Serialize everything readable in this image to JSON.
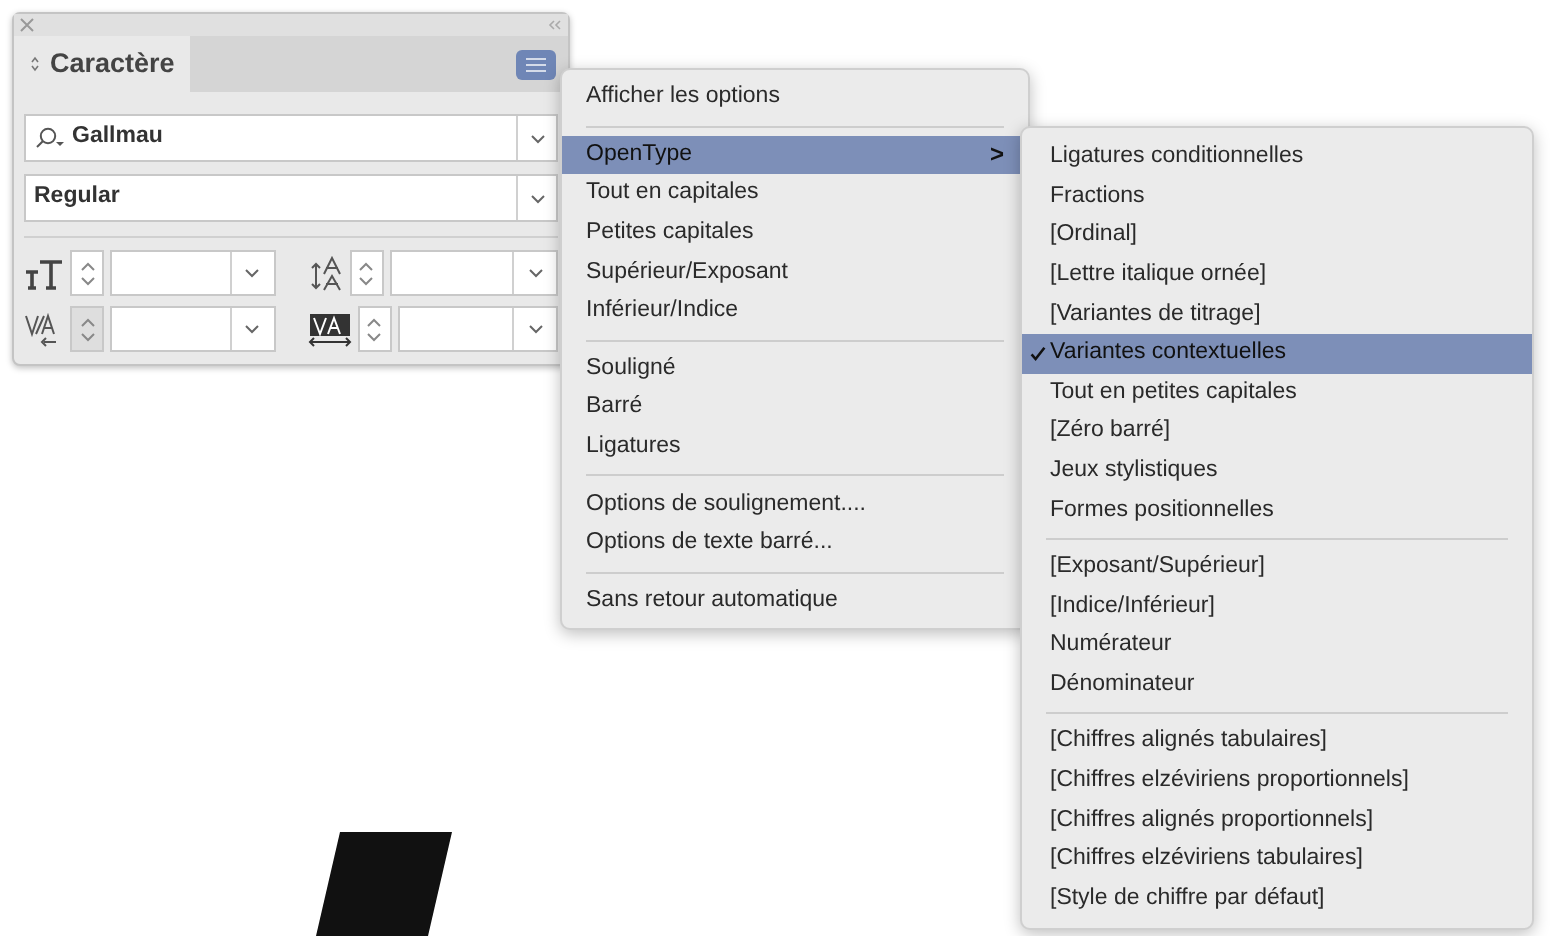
{
  "panel": {
    "tab": {
      "label": "Caractère",
      "selected": true
    },
    "font_family": {
      "value": "Gallmau"
    },
    "font_style": {
      "value": "Regular"
    }
  },
  "menu": {
    "items": [
      {
        "kind": "item",
        "label": "Afficher les options",
        "selected": false
      },
      {
        "kind": "separator"
      },
      {
        "kind": "submenu",
        "label": "OpenType",
        "arrow": ">",
        "selected": true
      },
      {
        "kind": "item",
        "label": "Tout en capitales",
        "selected": false
      },
      {
        "kind": "item",
        "label": "Petites capitales",
        "selected": false
      },
      {
        "kind": "item",
        "label": "Supérieur/Exposant",
        "selected": false
      },
      {
        "kind": "item",
        "label": "Inférieur/Indice",
        "selected": false
      },
      {
        "kind": "separator"
      },
      {
        "kind": "item",
        "label": "Souligné",
        "selected": false
      },
      {
        "kind": "item",
        "label": "Barré",
        "selected": false
      },
      {
        "kind": "item",
        "label": "Ligatures",
        "selected": false
      },
      {
        "kind": "separator"
      },
      {
        "kind": "item",
        "label": "Options de soulignement....",
        "selected": false
      },
      {
        "kind": "item",
        "label": "Options de texte barré...",
        "selected": false
      },
      {
        "kind": "separator"
      },
      {
        "kind": "item",
        "label": "Sans retour automatique",
        "selected": false
      }
    ]
  },
  "submenu": {
    "items": [
      {
        "kind": "item",
        "label": "Ligatures conditionnelles",
        "selected": false,
        "checked": false
      },
      {
        "kind": "item",
        "label": "Fractions",
        "selected": false,
        "checked": false
      },
      {
        "kind": "item",
        "label": "[Ordinal]",
        "selected": false,
        "checked": false
      },
      {
        "kind": "item",
        "label": "[Lettre italique ornée]",
        "selected": false,
        "checked": false
      },
      {
        "kind": "item",
        "label": "[Variantes de titrage]",
        "selected": false,
        "checked": false
      },
      {
        "kind": "item",
        "label": "Variantes contextuelles",
        "selected": true,
        "checked": true
      },
      {
        "kind": "item",
        "label": "Tout en petites capitales",
        "selected": false,
        "checked": false
      },
      {
        "kind": "item",
        "label": "[Zéro barré]",
        "selected": false,
        "checked": false
      },
      {
        "kind": "item",
        "label": "Jeux stylistiques",
        "selected": false,
        "checked": false
      },
      {
        "kind": "item",
        "label": "Formes positionnelles",
        "selected": false,
        "checked": false
      },
      {
        "kind": "separator"
      },
      {
        "kind": "item",
        "label": "[Exposant/Supérieur]",
        "selected": false,
        "checked": false
      },
      {
        "kind": "item",
        "label": "[Indice/Inférieur]",
        "selected": false,
        "checked": false
      },
      {
        "kind": "item",
        "label": "Numérateur",
        "selected": false,
        "checked": false
      },
      {
        "kind": "item",
        "label": "Dénominateur",
        "selected": false,
        "checked": false
      },
      {
        "kind": "separator"
      },
      {
        "kind": "item",
        "label": "[Chiffres alignés tabulaires]",
        "selected": false,
        "checked": false
      },
      {
        "kind": "item",
        "label": "[Chiffres elzéviriens proportionnels]",
        "selected": false,
        "checked": false
      },
      {
        "kind": "item",
        "label": "[Chiffres alignés proportionnels]",
        "selected": false,
        "checked": false
      },
      {
        "kind": "item",
        "label": "[Chiffres elzéviriens tabulaires]",
        "selected": false,
        "checked": false
      },
      {
        "kind": "item",
        "label": "[Style de chiffre par défaut]",
        "selected": false,
        "checked": false
      }
    ]
  }
}
